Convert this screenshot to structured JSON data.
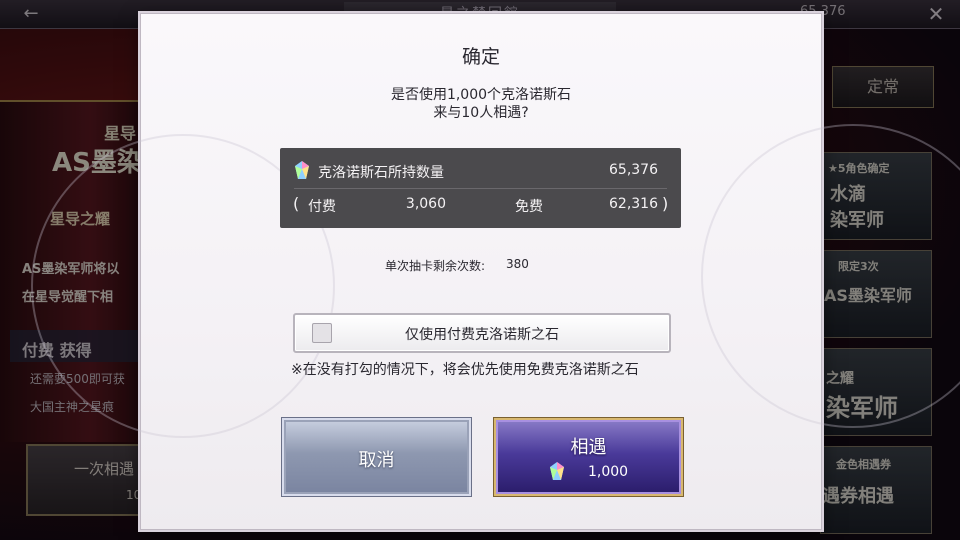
{
  "background": {
    "back_arrow": "←",
    "hall_title": "星之禁回館",
    "top_count": "65,376",
    "close": "✕",
    "left_banner": {
      "line1": "星导",
      "line2": "AS墨染",
      "line3": "星导之耀",
      "line4": "AS墨染军师将以",
      "line5": "在星导觉醒下相",
      "paid_get": "付费 获得",
      "need_text": "还需要500即可获",
      "seal_text": "大国主神之星痕",
      "summon_once": "一次相遇",
      "summon_cost": "10"
    },
    "right_panel": {
      "tab": "定常",
      "card1_top": "★5角色确定",
      "card1_main": "水滴\n染军师",
      "card2_top": "限定3次",
      "card2_main": "AS墨染军师",
      "card3_top": "之耀",
      "card3_main": "染军师",
      "card4_top": "金色相遇券",
      "card4_main": "遇券相遇"
    }
  },
  "dialog": {
    "title": "确定",
    "question_line1": "是否使用1,000个克洛诺斯石",
    "question_line2": "来与10人相遇?",
    "stone_panel": {
      "label": "克洛诺斯石所持数量",
      "total": "65,376",
      "lparen": "(",
      "paid_label": "付费",
      "paid_value": "3,060",
      "free_label": "免费",
      "free_value": "62,316",
      "rparen": ")"
    },
    "remaining_label": "单次抽卡剩余次数:",
    "remaining_value": "380",
    "paid_only_option": {
      "label": "仅使用付费克洛诺斯之石",
      "checked": false
    },
    "note": "※在没有打勾的情况下，将会优先使用免费克洛诺斯之石",
    "cancel_button": "取消",
    "confirm_button": "相遇",
    "confirm_cost": "1,000",
    "icons": {
      "stone": "crystal-icon",
      "checkbox": "checkbox-icon"
    },
    "colors": {
      "panel_bg": "#4b4a4d",
      "confirm_button": "#4a3a9a",
      "confirm_border": "#d8b870",
      "cancel_button": "#8e98b0"
    }
  }
}
